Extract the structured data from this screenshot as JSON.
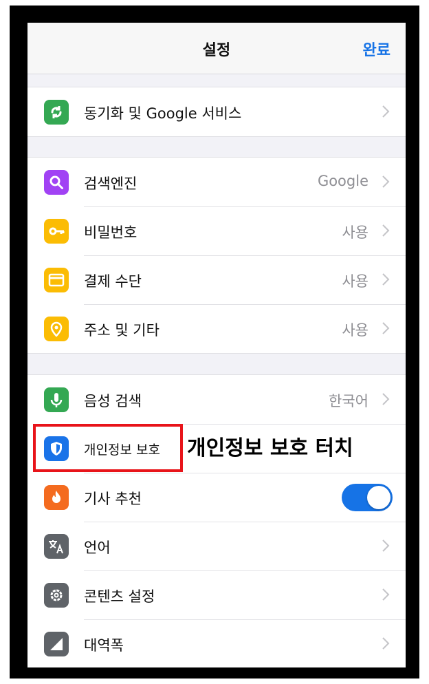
{
  "nav": {
    "title": "설정",
    "done": "완료"
  },
  "group1": [
    {
      "label": "동기화 및 Google 서비스",
      "value": "",
      "icon": "sync-icon",
      "color": "#34a853"
    }
  ],
  "group2": [
    {
      "label": "검색엔진",
      "value": "Google",
      "icon": "search-icon",
      "color": "#a142f4"
    },
    {
      "label": "비밀번호",
      "value": "사용",
      "icon": "key-icon",
      "color": "#fbbc04"
    },
    {
      "label": "결제 수단",
      "value": "사용",
      "icon": "credit-card-icon",
      "color": "#fbbc04"
    },
    {
      "label": "주소 및 기타",
      "value": "사용",
      "icon": "location-pin-icon",
      "color": "#fbbc04"
    }
  ],
  "group3": [
    {
      "label": "음성 검색",
      "value": "한국어",
      "icon": "microphone-icon",
      "color": "#34a853"
    },
    {
      "label": "개인정보 보호",
      "value": "",
      "icon": "shield-icon",
      "color": "#1a73e8"
    },
    {
      "label": "기사 추천",
      "value": "",
      "icon": "flame-icon",
      "color": "#f46b1f",
      "toggle": "on"
    },
    {
      "label": "언어",
      "value": "",
      "icon": "translate-icon",
      "color": "#5f6368"
    },
    {
      "label": "콘텐츠 설정",
      "value": "",
      "icon": "gear-icon",
      "color": "#5f6368"
    },
    {
      "label": "대역폭",
      "value": "",
      "icon": "bandwidth-icon",
      "color": "#5f6368"
    }
  ],
  "annotation": {
    "text": "개인정보 보호 터치"
  },
  "colors": {
    "accent": "#1673e6",
    "highlight": "#e8141a"
  }
}
